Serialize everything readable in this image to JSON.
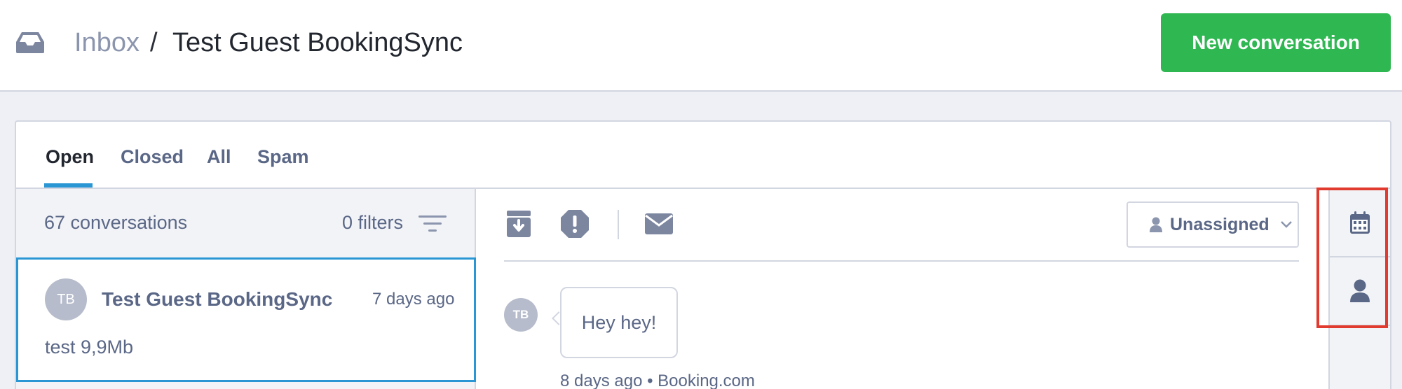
{
  "colors": {
    "accent_green": "#2fb752",
    "tab_active_underline": "#2a97d4",
    "selection_border": "#2a97d4",
    "muted_text": "#5a6786",
    "highlight_box": "#e13a2e"
  },
  "header": {
    "icon": "inbox-tray-icon",
    "breadcrumb_root": "Inbox",
    "breadcrumb_sep": "/",
    "breadcrumb_current": "Test Guest BookingSync",
    "new_conversation_label": "New conversation"
  },
  "tabs": [
    {
      "label": "Open",
      "active": true
    },
    {
      "label": "Closed",
      "active": false
    },
    {
      "label": "All",
      "active": false
    },
    {
      "label": "Spam",
      "active": false
    }
  ],
  "list": {
    "count_label": "67 conversations",
    "filters_label": "0 filters",
    "filter_icon": "filter-lines-icon",
    "items": [
      {
        "initials": "TB",
        "name": "Test Guest BookingSync",
        "time": "7 days ago",
        "preview": "test 9,9Mb",
        "selected": true
      }
    ]
  },
  "toolbar": {
    "archive_icon": "archive-icon",
    "spam_icon": "spam-alert-icon",
    "mail_icon": "mail-icon",
    "assignee_label": "Unassigned"
  },
  "messages": [
    {
      "initials": "TB",
      "text": "Hey hey!",
      "meta": "8 days ago • Booking.com"
    }
  ],
  "sidebar": {
    "calendar_icon": "calendar-icon",
    "user_icon": "user-icon"
  }
}
